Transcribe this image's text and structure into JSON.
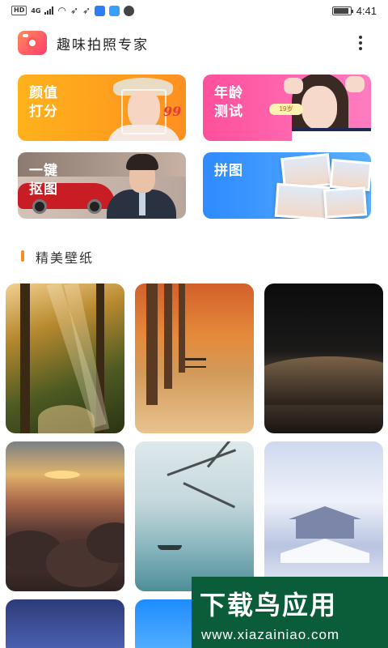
{
  "status_bar": {
    "hd": "HD",
    "network": "4G",
    "time": "4:41",
    "battery_level": 0.9,
    "icons": [
      "signal-icon",
      "wifi-icon",
      "rocket-icon",
      "rocket-icon",
      "shield-icon",
      "cloud-icon",
      "compass-icon"
    ]
  },
  "app": {
    "title": "趣味拍照专家",
    "logo_icon": "camera-icon",
    "menu_icon": "more-vertical-icon"
  },
  "features": [
    {
      "id": "score",
      "label": "颜值\n打分",
      "score_text": "99"
    },
    {
      "id": "age",
      "label": "年龄\n测试",
      "badge_text": "19岁"
    },
    {
      "id": "cutout",
      "label": "一键\n抠图"
    },
    {
      "id": "collage",
      "label": "拼图"
    }
  ],
  "section": {
    "title": "精美壁纸",
    "accent": "#ff8a1f"
  },
  "wallpapers": [
    {
      "id": "forest"
    },
    {
      "id": "autumn"
    },
    {
      "id": "dune"
    },
    {
      "id": "clouds"
    },
    {
      "id": "lake"
    },
    {
      "id": "snow"
    },
    {
      "id": "city"
    },
    {
      "id": "blue"
    }
  ],
  "watermark": {
    "main": "下载鸟应用",
    "url": "www.xiazainiao.com"
  }
}
